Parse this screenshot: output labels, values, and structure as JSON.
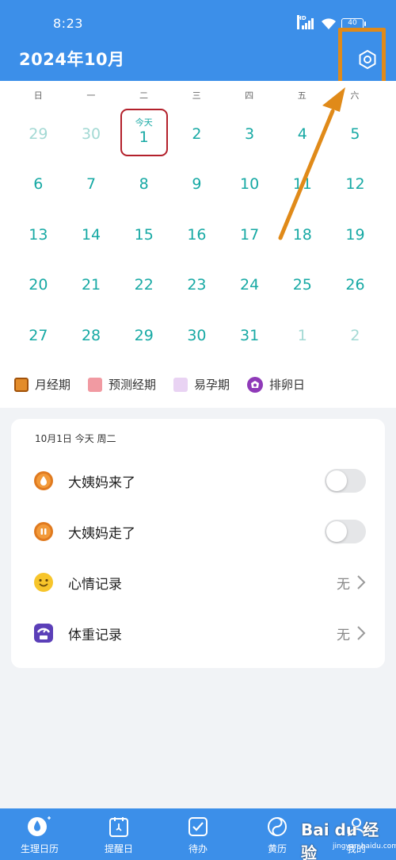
{
  "status_bar": {
    "time": "8:23",
    "battery": "40",
    "network": "HD"
  },
  "header": {
    "title": "2024年10月",
    "settings_icon": "gear-icon"
  },
  "calendar": {
    "weekdays": [
      "日",
      "一",
      "二",
      "三",
      "四",
      "五",
      "六"
    ],
    "today_label": "今天",
    "weeks": [
      [
        {
          "d": "29",
          "other": true
        },
        {
          "d": "30",
          "other": true
        },
        {
          "d": "1",
          "today": true
        },
        {
          "d": "2"
        },
        {
          "d": "3"
        },
        {
          "d": "4"
        },
        {
          "d": "5"
        }
      ],
      [
        {
          "d": "6"
        },
        {
          "d": "7"
        },
        {
          "d": "8"
        },
        {
          "d": "9"
        },
        {
          "d": "10"
        },
        {
          "d": "11"
        },
        {
          "d": "12"
        }
      ],
      [
        {
          "d": "13"
        },
        {
          "d": "14"
        },
        {
          "d": "15"
        },
        {
          "d": "16"
        },
        {
          "d": "17"
        },
        {
          "d": "18"
        },
        {
          "d": "19"
        }
      ],
      [
        {
          "d": "20"
        },
        {
          "d": "21"
        },
        {
          "d": "22"
        },
        {
          "d": "23"
        },
        {
          "d": "24"
        },
        {
          "d": "25"
        },
        {
          "d": "26"
        }
      ],
      [
        {
          "d": "27"
        },
        {
          "d": "28"
        },
        {
          "d": "29"
        },
        {
          "d": "30"
        },
        {
          "d": "31"
        },
        {
          "d": "1",
          "other": true
        },
        {
          "d": "2",
          "other": true
        }
      ]
    ]
  },
  "legend": {
    "period": "月经期",
    "predicted": "预测经期",
    "fertile": "易孕期",
    "ovulation": "排卵日"
  },
  "card": {
    "date_line": "10月1日 今天 周二",
    "rows": [
      {
        "label": "大姨妈来了",
        "type": "toggle",
        "icon": "drop-icon"
      },
      {
        "label": "大姨妈走了",
        "type": "toggle",
        "icon": "pause-drop-icon"
      },
      {
        "label": "心情记录",
        "type": "value",
        "value": "无",
        "icon": "smiley-icon"
      },
      {
        "label": "体重记录",
        "type": "value",
        "value": "无",
        "icon": "scale-icon"
      }
    ]
  },
  "bottom_nav": {
    "items": [
      {
        "label": "生理日历",
        "icon": "drop-icon"
      },
      {
        "label": "提醒日",
        "icon": "reminder-icon"
      },
      {
        "label": "待办",
        "icon": "checkbox-icon"
      },
      {
        "label": "黄历",
        "icon": "yin-yang-icon"
      },
      {
        "label": "我的",
        "icon": "user-icon"
      }
    ]
  },
  "watermark": {
    "brand": "Bai du 经验",
    "url": "jingyan.baidu.com"
  },
  "colors": {
    "primary": "#3c8fe9",
    "date_teal": "#17a9a4",
    "today_border": "#b3202b",
    "annotation": "#e08a19"
  }
}
